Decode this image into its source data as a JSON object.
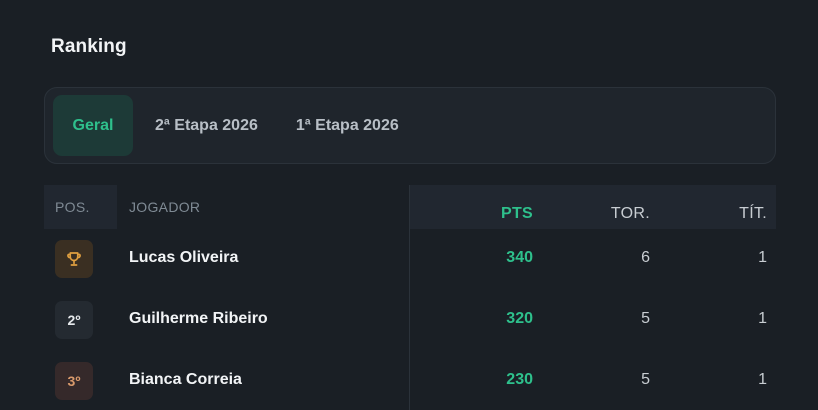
{
  "title": "Ranking",
  "tabs": [
    {
      "label": "Geral",
      "active": true
    },
    {
      "label": "2ª Etapa 2026",
      "active": false
    },
    {
      "label": "1ª Etapa 2026",
      "active": false
    }
  ],
  "table": {
    "headers": {
      "pos": "POS.",
      "player": "JOGADOR",
      "pts": "PTS",
      "tor": "TOR.",
      "tit": "TÍT."
    },
    "rows": [
      {
        "pos": "",
        "pos_icon": "trophy-icon",
        "player": "Lucas Oliveira",
        "pts": "340",
        "tor": "6",
        "tit": "1"
      },
      {
        "pos": "2º",
        "player": "Guilherme Ribeiro",
        "pts": "320",
        "tor": "5",
        "tit": "1"
      },
      {
        "pos": "3º",
        "player": "Bianca Correia",
        "pts": "230",
        "tor": "5",
        "tit": "1"
      }
    ]
  },
  "colors": {
    "accent": "#2ec08c",
    "background": "#1a1f25",
    "gold": "#e0a040",
    "bronze": "#d99a6c"
  }
}
